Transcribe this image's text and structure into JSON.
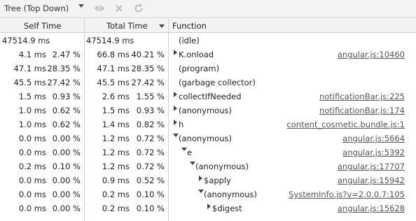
{
  "toolbar": {
    "view_mode": "Tree (Top Down)",
    "icons": [
      "dropdown-arrow-icon",
      "eye-icon",
      "close-icon",
      "reload-icon"
    ]
  },
  "columns": {
    "self_time": "Self Time",
    "total_time": "Total Time",
    "function": "Function"
  },
  "rows": [
    {
      "self_ms": "47514.9 ms",
      "self_pct": "",
      "total_ms": "47514.9 ms",
      "total_pct": "",
      "name": "(idle)",
      "link": "",
      "indent": 0,
      "toggle": "none"
    },
    {
      "self_ms": "4.1 ms",
      "self_pct": "2.47 %",
      "total_ms": "66.8 ms",
      "total_pct": "40.21 %",
      "name": "K.onload",
      "link": "angular.js:10460",
      "indent": 0,
      "toggle": "collapsed"
    },
    {
      "self_ms": "47.1 ms",
      "self_pct": "28.35 %",
      "total_ms": "47.1 ms",
      "total_pct": "28.35 %",
      "name": "(program)",
      "link": "",
      "indent": 0,
      "toggle": "none"
    },
    {
      "self_ms": "45.5 ms",
      "self_pct": "27.42 %",
      "total_ms": "45.5 ms",
      "total_pct": "27.42 %",
      "name": "(garbage collector)",
      "link": "",
      "indent": 0,
      "toggle": "none"
    },
    {
      "self_ms": "1.5 ms",
      "self_pct": "0.93 %",
      "total_ms": "2.6 ms",
      "total_pct": "1.55 %",
      "name": "collectIfNeeded",
      "link": "notificationBar.js:225",
      "indent": 0,
      "toggle": "collapsed"
    },
    {
      "self_ms": "1.0 ms",
      "self_pct": "0.62 %",
      "total_ms": "1.5 ms",
      "total_pct": "0.93 %",
      "name": "(anonymous)",
      "link": "notificationBar.js:174",
      "indent": 0,
      "toggle": "collapsed"
    },
    {
      "self_ms": "1.0 ms",
      "self_pct": "0.62 %",
      "total_ms": "1.4 ms",
      "total_pct": "0.82 %",
      "name": "h",
      "link": "content_cosmetic.bundle.js:1",
      "indent": 0,
      "toggle": "collapsed"
    },
    {
      "self_ms": "0.0 ms",
      "self_pct": "0.00 %",
      "total_ms": "1.2 ms",
      "total_pct": "0.72 %",
      "name": "(anonymous)",
      "link": "angular.js:5664",
      "indent": 0,
      "toggle": "expanded"
    },
    {
      "self_ms": "0.0 ms",
      "self_pct": "0.00 %",
      "total_ms": "1.2 ms",
      "total_pct": "0.72 %",
      "name": "e",
      "link": "angular.js:5392",
      "indent": 1,
      "toggle": "expanded"
    },
    {
      "self_ms": "0.2 ms",
      "self_pct": "0.10 %",
      "total_ms": "1.2 ms",
      "total_pct": "0.72 %",
      "name": "(anonymous)",
      "link": "angular.js:17707",
      "indent": 2,
      "toggle": "expanded"
    },
    {
      "self_ms": "0.0 ms",
      "self_pct": "0.00 %",
      "total_ms": "0.9 ms",
      "total_pct": "0.52 %",
      "name": "$apply",
      "link": "angular.js:15942",
      "indent": 3,
      "toggle": "collapsed"
    },
    {
      "self_ms": "0.0 ms",
      "self_pct": "0.00 %",
      "total_ms": "0.2 ms",
      "total_pct": "0.10 %",
      "name": "(anonymous)",
      "link": "SystemInfo.js?v=2.0.0.7:105",
      "indent": 3,
      "toggle": "expanded"
    },
    {
      "self_ms": "0.0 ms",
      "self_pct": "0.00 %",
      "total_ms": "0.2 ms",
      "total_pct": "0.10 %",
      "name": "$digest",
      "link": "angular.js:15628",
      "indent": 4,
      "toggle": "collapsed"
    }
  ]
}
